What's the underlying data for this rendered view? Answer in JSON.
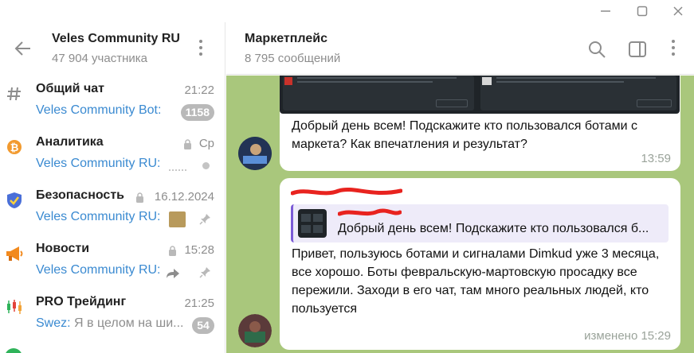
{
  "window": {
    "controls": [
      "minimize-icon",
      "maximize-icon",
      "close-icon"
    ]
  },
  "group": {
    "title": "Veles Community RU",
    "members": "47 904 участника"
  },
  "chats": [
    {
      "icon": "hashtag-icon",
      "name": "Общий чат",
      "time": "21:22",
      "sender": "Veles Community Bot:",
      "preview": "",
      "badge": "1158",
      "locked": false,
      "pinned": false
    },
    {
      "icon": "bitcoin-icon",
      "name": "Аналитика",
      "time": "Ср",
      "sender": "Veles Community RU:",
      "preview": "",
      "badge": "",
      "locked": true,
      "pinned": false
    },
    {
      "icon": "shield-icon",
      "name": "Безопасность",
      "time": "16.12.2024",
      "sender": "Veles Community RU:",
      "preview": "",
      "badge": "",
      "locked": true,
      "pinned": true
    },
    {
      "icon": "megaphone-icon",
      "name": "Новости",
      "time": "15:28",
      "sender": "Veles Community RU:",
      "preview": "",
      "badge": "",
      "locked": true,
      "pinned": true
    },
    {
      "icon": "candles-icon",
      "name": "PRO Трейдинг",
      "time": "21:25",
      "sender": "Swez:",
      "preview": "Я в целом на ши...",
      "badge": "54",
      "locked": false,
      "pinned": false
    }
  ],
  "topic": {
    "title": "Маркетплейс",
    "count": "8 795 сообщений"
  },
  "messages": [
    {
      "text": "Добрый день всем! Подскажите кто пользовался ботами с маркета? Как впечатления и результат?",
      "time": "13:59"
    },
    {
      "reply_quote": "Добрый день всем! Подскажите кто пользовался б...",
      "text": "Привет, пользуюсь ботами и сигналами Dimkud уже 3 месяца, все хорошо. Боты февральскую-мартовскую просадку все пережили. Заходи в его чат, там много реальных людей, кто пользуется",
      "time": "изменено 15:29"
    }
  ],
  "colors": {
    "accent": "#3a8ad1",
    "chat_background": "#a9c77c",
    "reply_bar": "#7b5bd6",
    "badge": "#b9b9b9"
  }
}
